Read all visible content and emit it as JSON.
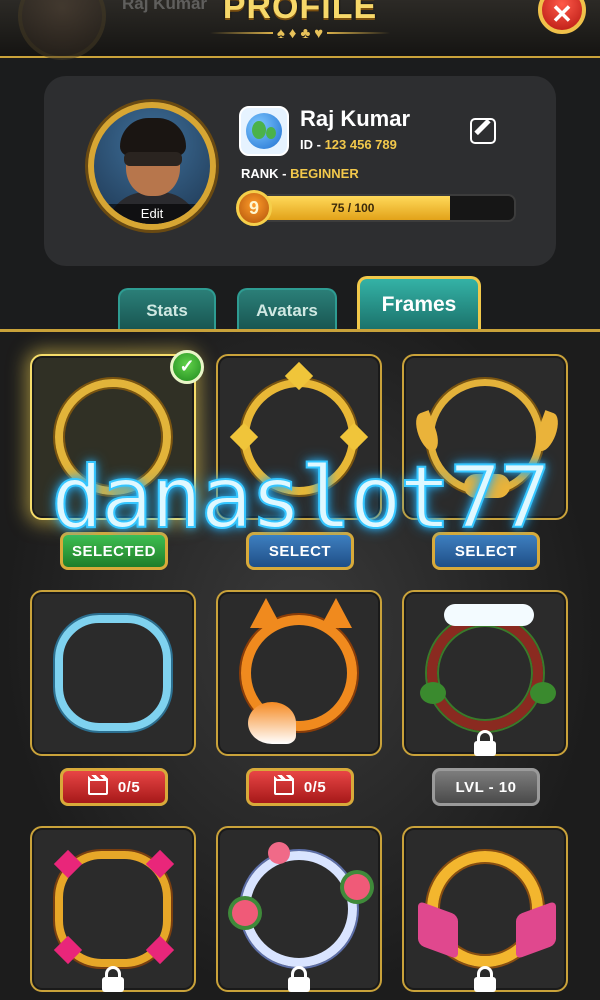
{
  "header": {
    "title": "PROFILE",
    "partial_name": "Raj Kumar",
    "suits": [
      "♠",
      "♦",
      "♣",
      "♥"
    ],
    "close_icon": "close-icon"
  },
  "profile": {
    "name": "Raj Kumar",
    "id_label": "ID -",
    "id_value": "123 456 789",
    "rank_label": "RANK -",
    "rank_value": "BEGINNER",
    "avatar_edit": "Edit",
    "level": "9",
    "xp_text": "75 / 100",
    "xp_progress": 0.75,
    "country_icon": "globe-icon"
  },
  "tabs": [
    {
      "label": "Stats",
      "active": false
    },
    {
      "label": "Avatars",
      "active": false
    },
    {
      "label": "Frames",
      "active": true
    }
  ],
  "frames": [
    {
      "style": "gold-ring",
      "button": "SELECTED",
      "button_type": "green",
      "selected": true,
      "locked": false
    },
    {
      "style": "gold-spiked",
      "button": "SELECT",
      "button_type": "blue",
      "selected": false,
      "locked": false
    },
    {
      "style": "gold-ornate",
      "button": "SELECT",
      "button_type": "blue",
      "selected": false,
      "locked": false
    },
    {
      "style": "ice",
      "button": "0/5",
      "button_type": "red",
      "icon": "clapperboard-icon",
      "selected": false,
      "locked": false
    },
    {
      "style": "fox",
      "button": "0/5",
      "button_type": "red",
      "icon": "clapperboard-icon",
      "selected": false,
      "locked": false
    },
    {
      "style": "christmas-wreath",
      "button": "LVL - 10",
      "button_type": "grey",
      "selected": false,
      "locked": true
    },
    {
      "style": "ruby-gold",
      "selected": false,
      "locked": true
    },
    {
      "style": "floral",
      "selected": false,
      "locked": true
    },
    {
      "style": "ribbon-gold",
      "selected": false,
      "locked": true
    }
  ],
  "watermark": "danaslot77",
  "colors": {
    "gold": "#c9a23a",
    "tab_teal": "#1a6f68",
    "select_green": "#1e7d2a",
    "select_blue": "#1f4f87",
    "ad_red": "#a61919",
    "locked_grey": "#4a4a4a"
  }
}
